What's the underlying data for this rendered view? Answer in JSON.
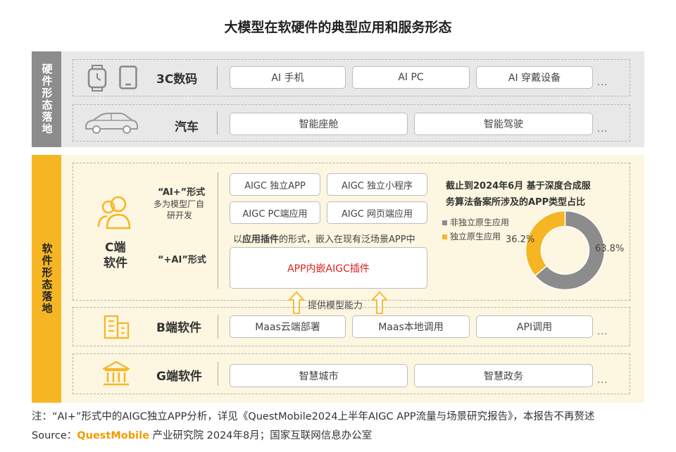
{
  "title": "大模型在软硬件的典型应用和服务形态",
  "hardware": {
    "side_label": "硬件形态落地",
    "rows": [
      {
        "label": "3C数码",
        "items": [
          "AI 手机",
          "AI PC",
          "AI 穿戴设备"
        ],
        "more": "..."
      },
      {
        "label": "汽车",
        "items": [
          "智能座舱",
          "智能驾驶"
        ],
        "more": "..."
      }
    ]
  },
  "software": {
    "side_label": "软件形态落地",
    "c_end": {
      "label_line1": "C端",
      "label_line2": "软件",
      "form_ai_plus": "“AI+”形式",
      "form_ai_plus_sub1": "多为模型厂自",
      "form_ai_plus_sub2": "研开发",
      "form_plus_ai": "“+AI”形式",
      "items": [
        "AIGC 独立APP",
        "AIGC 独立小程序",
        "AIGC PC端应用",
        "AIGC 网页端应用"
      ],
      "plugin_prefix": "以",
      "plugin_bold": "应用插件",
      "plugin_suffix": "的形式，嵌入在现有泛场景APP中",
      "plugin_box": "APP内嵌AIGC插件",
      "capability": "提供模型能力"
    },
    "b_end": {
      "label": "B端软件",
      "items": [
        "Maas云端部署",
        "Maas本地调用",
        "API调用"
      ],
      "more": "..."
    },
    "g_end": {
      "label": "G端软件",
      "items": [
        "智慧城市",
        "智慧政务"
      ],
      "more": "..."
    }
  },
  "chart_data": {
    "type": "pie",
    "title": "截止到2024年6月 基于深度合成服务算法备案所涉及的APP类型占比",
    "title_line1": "截止到2024年6月 基于深度合成服",
    "title_line2": "务算法备案所涉及的APP类型占比",
    "categories": [
      "非独立原生应用",
      "独立原生应用"
    ],
    "values": [
      63.8,
      36.2
    ],
    "labels": [
      "63.8%",
      "36.2%"
    ],
    "colors": [
      "#8c8c8c",
      "#f6b624"
    ],
    "legend": "top-left"
  },
  "footer": {
    "note": "注：“AI+”形式中的AIGC独立APP分析，详见《QuestMobile2024上半年AIGC APP流量与场景研究报告》，本报告不再赘述",
    "source_prefix": "Source：",
    "source_brand": "QuestMobile",
    "source_suffix": " 产业研究院 2024年8月；国家互联网信息办公室"
  },
  "colors": {
    "accent": "#f6b624",
    "gray": "#8c8c8c",
    "red_text": "#e02020"
  }
}
